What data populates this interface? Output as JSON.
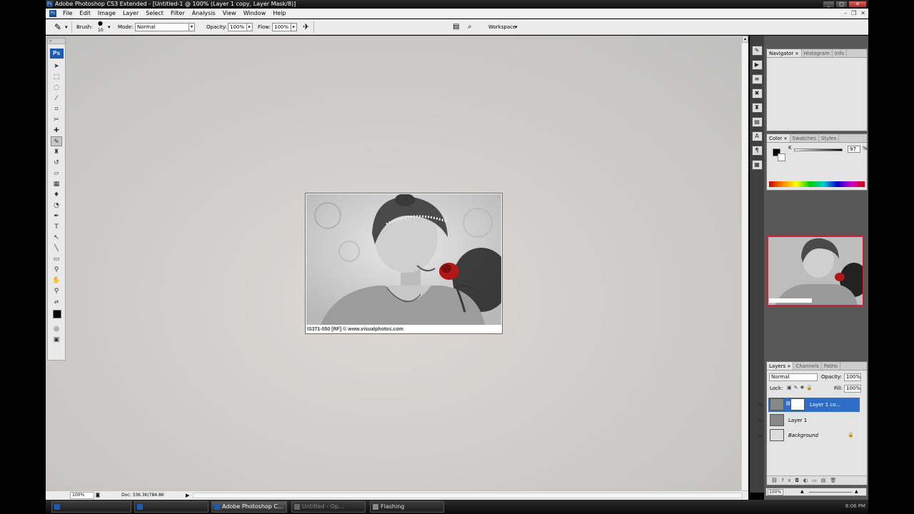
{
  "window": {
    "title": "Adobe Photoshop CS3 Extended - [Untitled-1 @ 100% (Layer 1 copy, Layer Mask/8)]",
    "buttons": {
      "minimize": "_",
      "maximize": "□",
      "close": "✕"
    }
  },
  "menu": {
    "items": [
      "File",
      "Edit",
      "Image",
      "Layer",
      "Select",
      "Filter",
      "Analysis",
      "View",
      "Window",
      "Help"
    ]
  },
  "options": {
    "brush_label": "Brush:",
    "brush_size": "10",
    "mode_label": "Mode:",
    "mode_value": "Normal",
    "opacity_label": "Opacity:",
    "opacity_value": "100%",
    "flow_label": "Flow:",
    "flow_value": "100%",
    "workspace_label": "Workspace"
  },
  "toolbox": {
    "badge": "Ps",
    "tools": [
      "move",
      "marquee",
      "lasso",
      "magic-wand",
      "crop",
      "slice",
      "healing",
      "brush",
      "clone-stamp",
      "history-brush",
      "eraser",
      "gradient",
      "blur",
      "dodge",
      "pen",
      "type",
      "path-select",
      "shape",
      "notes",
      "eyedropper",
      "hand",
      "zoom"
    ]
  },
  "document": {
    "caption": "IS371-050 [RF] © www.visualphotos.com"
  },
  "status": {
    "zoom": "100%",
    "doc_size": "Doc: 336.3K/784.8K"
  },
  "navigator": {
    "tabs": [
      "Navigator",
      "Histogram",
      "Info"
    ]
  },
  "color": {
    "tabs": [
      "Color",
      "Swatches",
      "Styles"
    ],
    "k_label": "K",
    "k_value": "97",
    "k_unit": "%"
  },
  "layers": {
    "tabs": [
      "Layers",
      "Channels",
      "Paths"
    ],
    "blend_mode": "Normal",
    "opacity_label": "Opacity:",
    "opacity_value": "100%",
    "lock_label": "Lock:",
    "fill_label": "Fill:",
    "fill_value": "100%",
    "items": [
      {
        "name": "Layer 1 co...",
        "selected": true
      },
      {
        "name": "Layer 1",
        "selected": false
      },
      {
        "name": "Background",
        "selected": false
      }
    ]
  },
  "panel_zoom": "100%",
  "taskbar": {
    "items": [
      "",
      "",
      "Adobe Photoshop C...",
      "Untitled - Op...",
      "Flashing"
    ],
    "clock": "8:06 PM"
  }
}
